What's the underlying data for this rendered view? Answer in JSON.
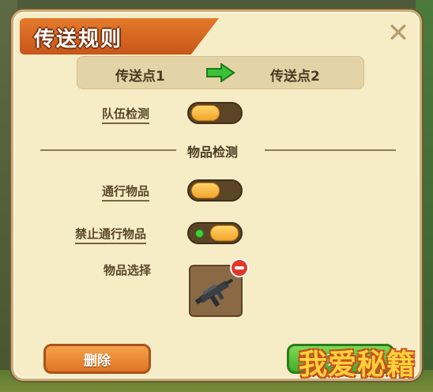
{
  "dialog": {
    "title": "传送规则",
    "close_icon": "close-icon"
  },
  "route": {
    "from": "传送点1",
    "to": "传送点2",
    "arrow_icon": "green-arrow-right-icon",
    "arrow_color": "#3cc23a"
  },
  "team_check": {
    "label": "队伍检测",
    "enabled": false
  },
  "item_check": {
    "section_title": "物品检测",
    "pass_items_label": "通行物品",
    "pass_items_enabled": false,
    "forbid_items_label": "禁止通行物品",
    "forbid_items_enabled": true,
    "item_select_label": "物品选择",
    "selected_item_icon": "submachine-gun-icon",
    "remove_icon": "remove-badge-icon"
  },
  "buttons": {
    "delete": "删除",
    "confirm": "确定"
  },
  "watermark": "我爱秘籍",
  "colors": {
    "accent_orange": "#e07424",
    "accent_green": "#3fae2a",
    "panel_bg": "#f6ecc6"
  }
}
